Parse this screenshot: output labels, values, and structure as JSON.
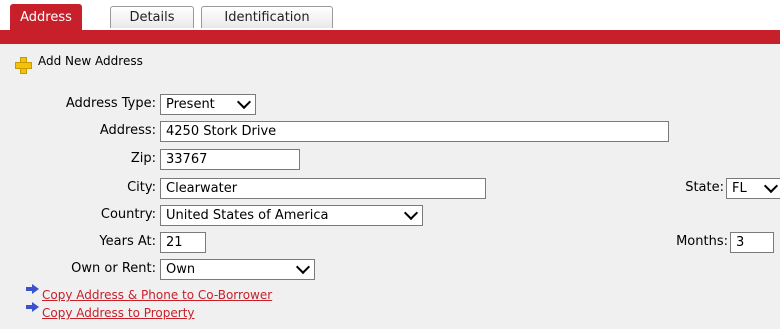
{
  "tabs": [
    {
      "label": "Address",
      "active": true
    },
    {
      "label": "Details",
      "active": false
    },
    {
      "label": "Identification",
      "active": false
    }
  ],
  "add_new_label": "Add New Address",
  "form": {
    "address_type": {
      "label": "Address Type:",
      "value": "Present"
    },
    "address": {
      "label": "Address:",
      "value": "4250 Stork Drive"
    },
    "zip": {
      "label": "Zip:",
      "value": "33767"
    },
    "city": {
      "label": "City:",
      "value": "Clearwater"
    },
    "state": {
      "label": "State:",
      "value": "FL"
    },
    "country": {
      "label": "Country:",
      "value": "United States of America"
    },
    "years_at": {
      "label": "Years At:",
      "value": "21"
    },
    "months": {
      "label": "Months:",
      "value": "3"
    },
    "own_or_rent": {
      "label": "Own or Rent:",
      "value": "Own"
    }
  },
  "links": {
    "copy_co_borrower": "Copy Address & Phone to Co-Borrower",
    "copy_property": "Copy Address to Property"
  },
  "colors": {
    "accent": "#c8202a",
    "panel": "#f0f0f0",
    "link_arrow": "#3c52c9"
  }
}
